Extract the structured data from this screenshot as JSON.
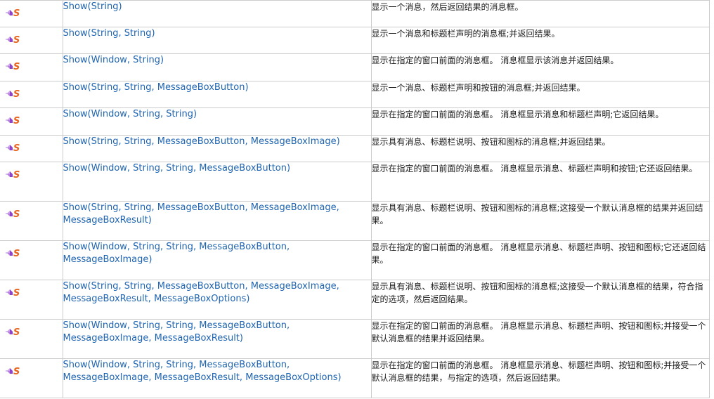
{
  "members": {
    "icons": {
      "method": "method-icon",
      "static": "static-icon"
    },
    "colors": {
      "link": "#1f64b0",
      "icon_purple": "#9b59c8",
      "icon_orange": "#e8641e",
      "border": "#cccccc"
    },
    "rows": [
      {
        "name": "Show(String)",
        "description": "显示一个消息，然后返回结果的消息框。"
      },
      {
        "name": "Show(String, String)",
        "description": "显示一个消息和标题栏声明的消息框;并返回结果。"
      },
      {
        "name": "Show(Window, String)",
        "description": "显示在指定的窗口前面的消息框。 消息框显示该消息并返回结果。"
      },
      {
        "name": "Show(String, String, MessageBoxButton)",
        "description": "显示一个消息、标题栏声明和按钮的消息框;并返回结果。"
      },
      {
        "name": "Show(Window, String, String)",
        "description": "显示在指定的窗口前面的消息框。 消息框显示消息和标题栏声明;它返回结果。"
      },
      {
        "name": "Show(String, String, MessageBoxButton, MessageBoxImage)",
        "description": "显示具有消息、标题栏说明、按钮和图标的消息框;并返回结果。"
      },
      {
        "name": "Show(Window, String, String, MessageBoxButton)",
        "description": "显示在指定的窗口前面的消息框。 消息框显示消息、标题栏声明和按钮;它还返回结果。"
      },
      {
        "name": "Show(String, String, MessageBoxButton, MessageBoxImage, MessageBoxResult)",
        "description": "显示具有消息、标题栏说明、按钮和图标的消息框;这接受一个默认消息框的结果并返回结果。"
      },
      {
        "name": "Show(Window, String, String, MessageBoxButton, MessageBoxImage)",
        "description": "显示在指定的窗口前面的消息框。 消息框显示消息、标题栏声明、按钮和图标;它还返回结果。"
      },
      {
        "name": "Show(String, String, MessageBoxButton, MessageBoxImage, MessageBoxResult, MessageBoxOptions)",
        "description": "显示具有消息、标题栏说明、按钮和图标的消息框;这接受一个默认消息框的结果，符合指定的选项，然后返回结果。"
      },
      {
        "name": "Show(Window, String, String, MessageBoxButton, MessageBoxImage, MessageBoxResult)",
        "description": "显示在指定的窗口前面的消息框。 消息框显示消息、标题栏声明、按钮和图标;并接受一个默认消息框的结果并返回结果。"
      },
      {
        "name": "Show(Window, String, String, MessageBoxButton, MessageBoxImage, MessageBoxResult, MessageBoxOptions)",
        "description": "显示在指定的窗口前面的消息框。 消息框显示消息、标题栏声明、按钮和图标;并接受一个默认消息框的结果，与指定的选项，然后返回结果。"
      }
    ]
  }
}
